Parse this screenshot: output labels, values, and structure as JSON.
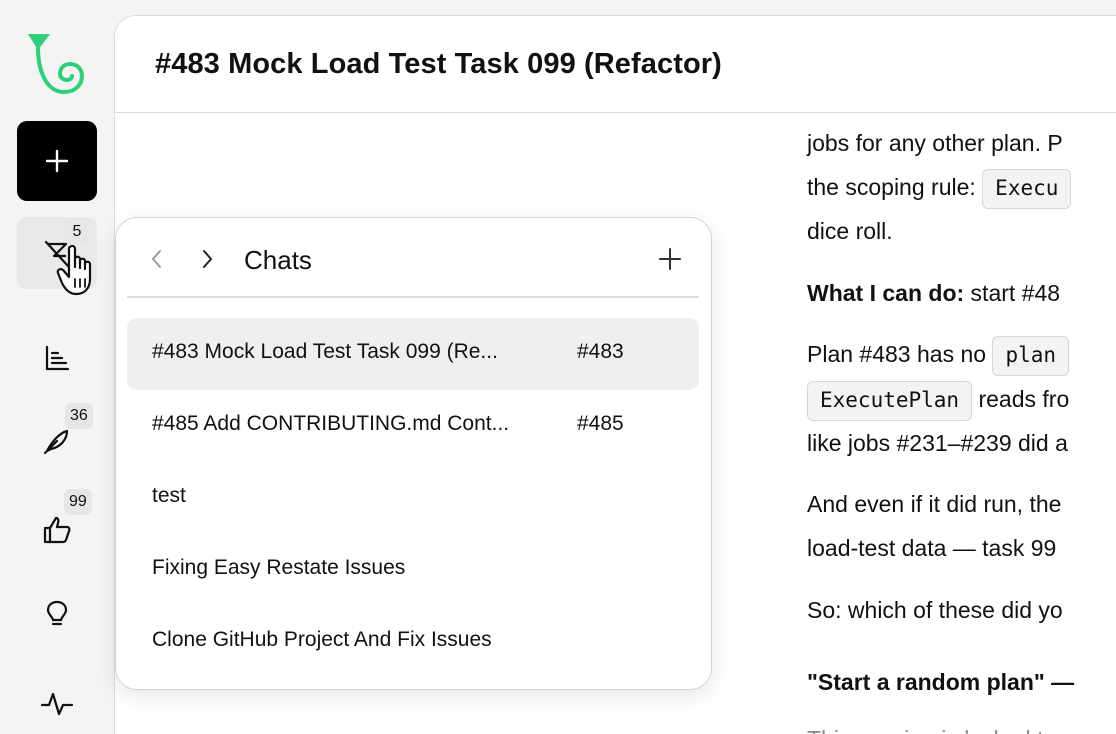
{
  "rail": {
    "notifications_badge": "5",
    "feedback_badge": "36",
    "likes_badge": "99"
  },
  "header": {
    "title": "#483 Mock Load Test Task 099 (Refactor)"
  },
  "content": {
    "l1": "jobs for any other plan. P",
    "l2_text": "the scoping rule: ",
    "l2_code": "Execu",
    "l3": "dice roll.",
    "l4_bold": "What I can do:",
    "l4_text": " start #48",
    "l5_text": "Plan #483 has no ",
    "l5_code": "plan",
    "l6_code": "ExecutePlan",
    "l6_text": " reads fro",
    "l7": "like jobs #231–#239 did a",
    "l8": "And even if it did run, the",
    "l9": "load-test data — task 99",
    "l10": "So: which of these did yo",
    "l11": "\"Start a random plan\" —",
    "l12": "This session is locked to"
  },
  "chats_popover": {
    "title": "Chats",
    "items": [
      {
        "title": "#483 Mock Load Test Task 099 (Re...",
        "id": "#483"
      },
      {
        "title": "#485 Add CONTRIBUTING.md Cont...",
        "id": "#485"
      },
      {
        "title": "test",
        "id": ""
      },
      {
        "title": "Fixing Easy Restate Issues",
        "id": ""
      },
      {
        "title": "Clone GitHub Project And Fix Issues",
        "id": ""
      }
    ]
  },
  "colors": {
    "accent_green": "#2ecf7a",
    "new_button_bg": "#000000",
    "selected_row": "#efefef"
  },
  "icons": [
    "logo-icon",
    "plus-icon",
    "notification-off-icon",
    "chart-icon",
    "feather-icon",
    "thumbs-up-icon",
    "lightbulb-icon",
    "activity-icon",
    "chevron-left-icon",
    "chevron-right-icon",
    "hand-cursor-icon"
  ]
}
